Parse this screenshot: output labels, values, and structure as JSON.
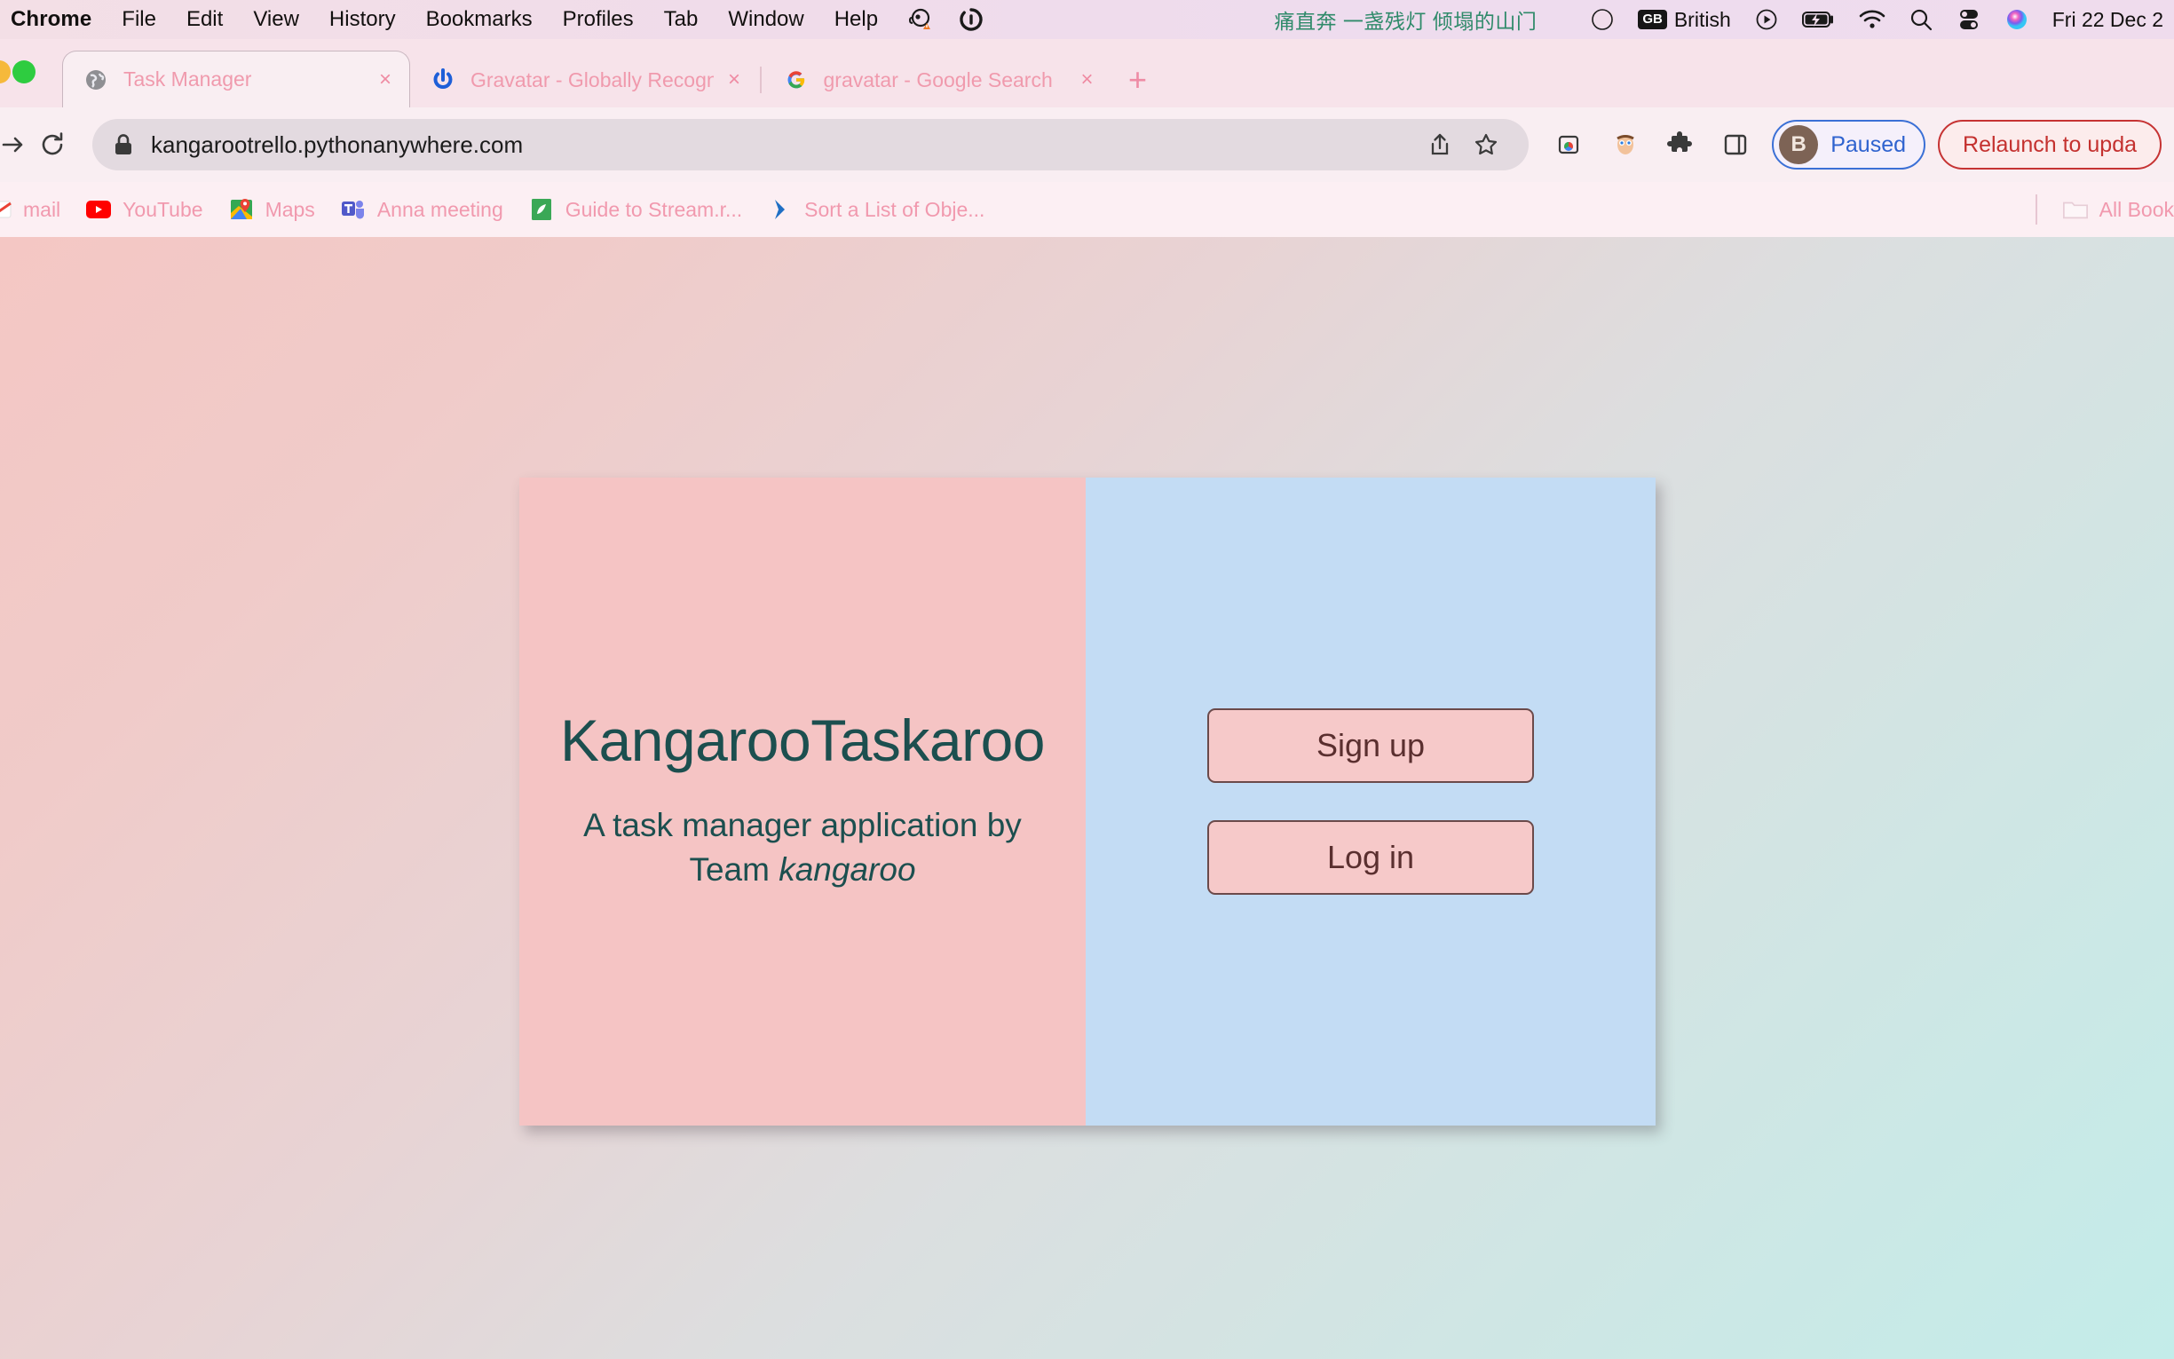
{
  "menubar": {
    "app_name": "Chrome",
    "items": [
      "File",
      "Edit",
      "View",
      "History",
      "Bookmarks",
      "Profiles",
      "Tab",
      "Window",
      "Help"
    ],
    "status_icons_left": [
      "monkey-alert-icon",
      "sync-spinner-icon"
    ],
    "now_playing_text": "痛直奔 一盏残灯 倾塌的山门",
    "status_icons_right": [
      "globe-icon",
      "play-circle-icon",
      "battery-charging-icon",
      "wifi-icon",
      "search-icon",
      "control-center-icon",
      "siri-icon"
    ],
    "keyboard_badge": "GB",
    "keyboard_label": "British",
    "datetime": "Fri 22 Dec 2"
  },
  "tabstrip": {
    "tabs": [
      {
        "title": "Task Manager",
        "favicon": "globe-icon",
        "active": true,
        "close": "×"
      },
      {
        "title": "Gravatar - Globally Recognize",
        "favicon": "gravatar-icon",
        "active": false,
        "close": "×"
      },
      {
        "title": "gravatar - Google Search",
        "favicon": "google-icon",
        "active": false,
        "close": "×"
      }
    ],
    "new_tab_label": "+"
  },
  "toolbar": {
    "forward_icon": "arrow-forward-icon",
    "reload_icon": "reload-icon",
    "lock_icon": "lock-icon",
    "url": "kangarootrello.pythonanywhere.com",
    "share_icon": "share-icon",
    "bookmark_star_icon": "star-icon",
    "extension_icons": [
      "tab-groups-icon",
      "face-extension-icon",
      "puzzle-extensions-icon",
      "side-panel-icon"
    ],
    "profile_initial": "B",
    "profile_status": "Paused",
    "relaunch_label": "Relaunch to upda"
  },
  "bookmarks": {
    "items": [
      {
        "label": "mail",
        "icon": "gmail-icon"
      },
      {
        "label": "YouTube",
        "icon": "youtube-icon"
      },
      {
        "label": "Maps",
        "icon": "maps-icon"
      },
      {
        "label": "Anna  meeting",
        "icon": "teams-icon"
      },
      {
        "label": "Guide to Stream.r...",
        "icon": "leaf-icon"
      },
      {
        "label": "Sort a List of Obje...",
        "icon": "chevron-icon"
      }
    ],
    "all_bookmarks_label": "All Book",
    "all_bookmarks_icon": "folder-icon"
  },
  "page": {
    "title": "KangarooTaskaroo",
    "subtitle_lead": "A task manager application by Team",
    "subtitle_team": "kangaroo",
    "signup_label": "Sign up",
    "login_label": "Log in",
    "colors": {
      "panel_pink": "#f5c4c4",
      "panel_blue": "#c3dcf4",
      "title_teal": "#1c4f4f",
      "button_pink": "#f6c9c9",
      "button_border": "#6b4a4a",
      "bg_start": "#f4c7c4",
      "bg_end": "#c3ece9"
    }
  }
}
